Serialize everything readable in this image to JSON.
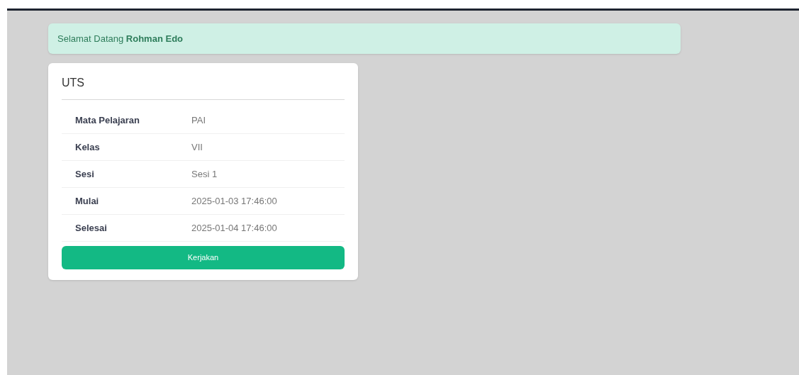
{
  "welcome": "Selamat Datang **Rohman Edo**",
  "card": {
    "title": "UTS",
    "rows": [
      {
        "label": "Mata Pelajaran",
        "value": "PAI"
      },
      {
        "label": "Kelas",
        "value": "VII"
      },
      {
        "label": "Sesi",
        "value": "Sesi 1"
      },
      {
        "label": "Mulai",
        "value": "2025-01-03 17:46:00"
      },
      {
        "label": "Selesai",
        "value": "2025-01-04 17:46:00"
      }
    ],
    "button": "Kerjakan"
  }
}
